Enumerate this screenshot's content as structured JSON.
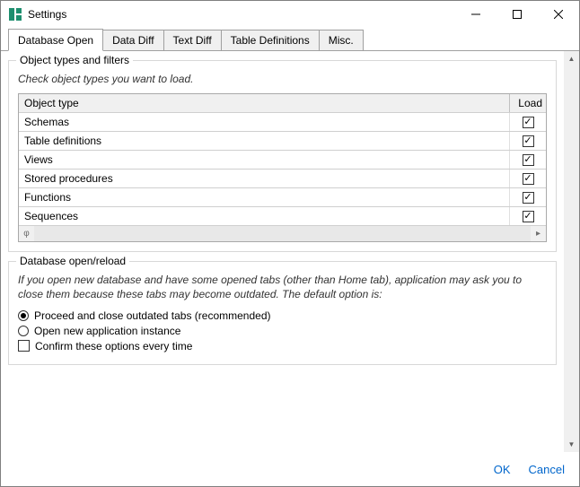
{
  "window": {
    "title": "Settings"
  },
  "tabs": [
    {
      "label": "Database Open",
      "active": true
    },
    {
      "label": "Data Diff",
      "active": false
    },
    {
      "label": "Text Diff",
      "active": false
    },
    {
      "label": "Table Definitions",
      "active": false
    },
    {
      "label": "Misc.",
      "active": false
    }
  ],
  "object_types_group": {
    "title": "Object types and filters",
    "instruction": "Check object types you want to load.",
    "header_name": "Object type",
    "header_load": "Load",
    "rows": [
      {
        "name": "Schemas",
        "checked": true
      },
      {
        "name": "Table definitions",
        "checked": true
      },
      {
        "name": "Views",
        "checked": true
      },
      {
        "name": "Stored procedures",
        "checked": true
      },
      {
        "name": "Functions",
        "checked": true
      },
      {
        "name": "Sequences",
        "checked": true
      }
    ]
  },
  "reload_group": {
    "title": "Database open/reload",
    "instruction": "If you open new database and have some opened tabs (other than Home tab), application may ask you to close them because these tabs may become outdated. The default option is:",
    "radios": [
      {
        "label": "Proceed and close outdated tabs (recommended)",
        "checked": true
      },
      {
        "label": "Open new application instance",
        "checked": false
      }
    ],
    "confirm_checkbox": {
      "label": "Confirm these options every time",
      "checked": false
    }
  },
  "buttons": {
    "ok": "OK",
    "cancel": "Cancel"
  }
}
